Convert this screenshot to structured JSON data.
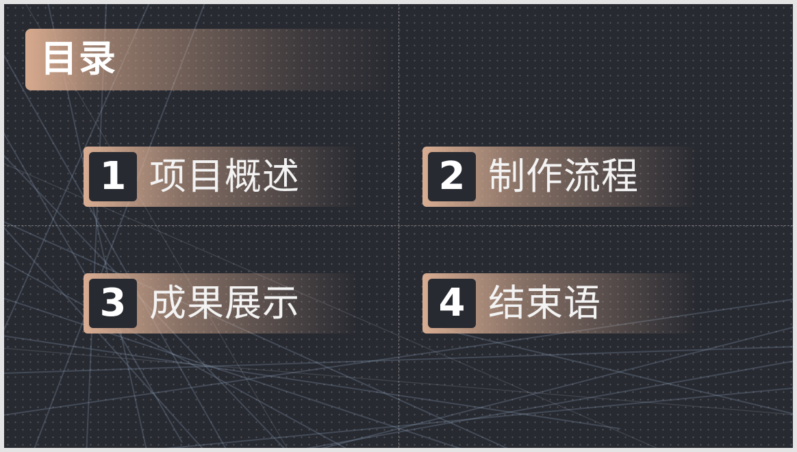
{
  "slide": {
    "title": "目录",
    "items": [
      {
        "number": "1",
        "label": "项目概述"
      },
      {
        "number": "2",
        "label": "制作流程"
      },
      {
        "number": "3",
        "label": "成果展示"
      },
      {
        "number": "4",
        "label": "结束语"
      }
    ]
  },
  "colors": {
    "background": "#282a31",
    "accent": "#d7aa8e",
    "text": "#ffffff"
  }
}
